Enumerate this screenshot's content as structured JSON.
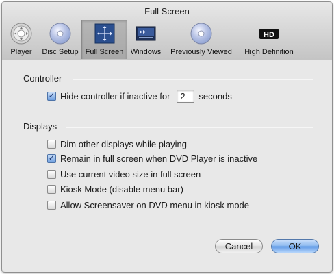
{
  "window": {
    "title": "Full Screen"
  },
  "toolbar": {
    "items": [
      {
        "label": "Player",
        "icon": "player-remote-icon",
        "selected": false
      },
      {
        "label": "Disc Setup",
        "icon": "disc-icon",
        "selected": false
      },
      {
        "label": "Full Screen",
        "icon": "full-screen-icon",
        "selected": true
      },
      {
        "label": "Windows",
        "icon": "window-icon",
        "selected": false
      },
      {
        "label": "Previously Viewed",
        "icon": "disc-icon",
        "selected": false
      },
      {
        "label": "High Definition",
        "icon": "hd-icon",
        "selected": false,
        "badge": "HD"
      }
    ]
  },
  "controller": {
    "title": "Controller",
    "hide_label": "Hide controller if inactive for",
    "hide_checked": true,
    "seconds_value": "2",
    "seconds_label": "seconds"
  },
  "displays": {
    "title": "Displays",
    "options": [
      {
        "label": "Dim other displays while playing",
        "checked": false
      },
      {
        "label": "Remain in full screen when DVD Player is inactive",
        "checked": true
      },
      {
        "label": "Use current video size in full screen",
        "checked": false
      },
      {
        "label": "Kiosk Mode (disable menu bar)",
        "checked": false
      },
      {
        "label": "Allow Screensaver on DVD menu in kiosk mode",
        "checked": false
      }
    ]
  },
  "buttons": {
    "cancel": "Cancel",
    "ok": "OK"
  },
  "colors": {
    "accent": "#6f9fdf",
    "check": "#16306b"
  }
}
